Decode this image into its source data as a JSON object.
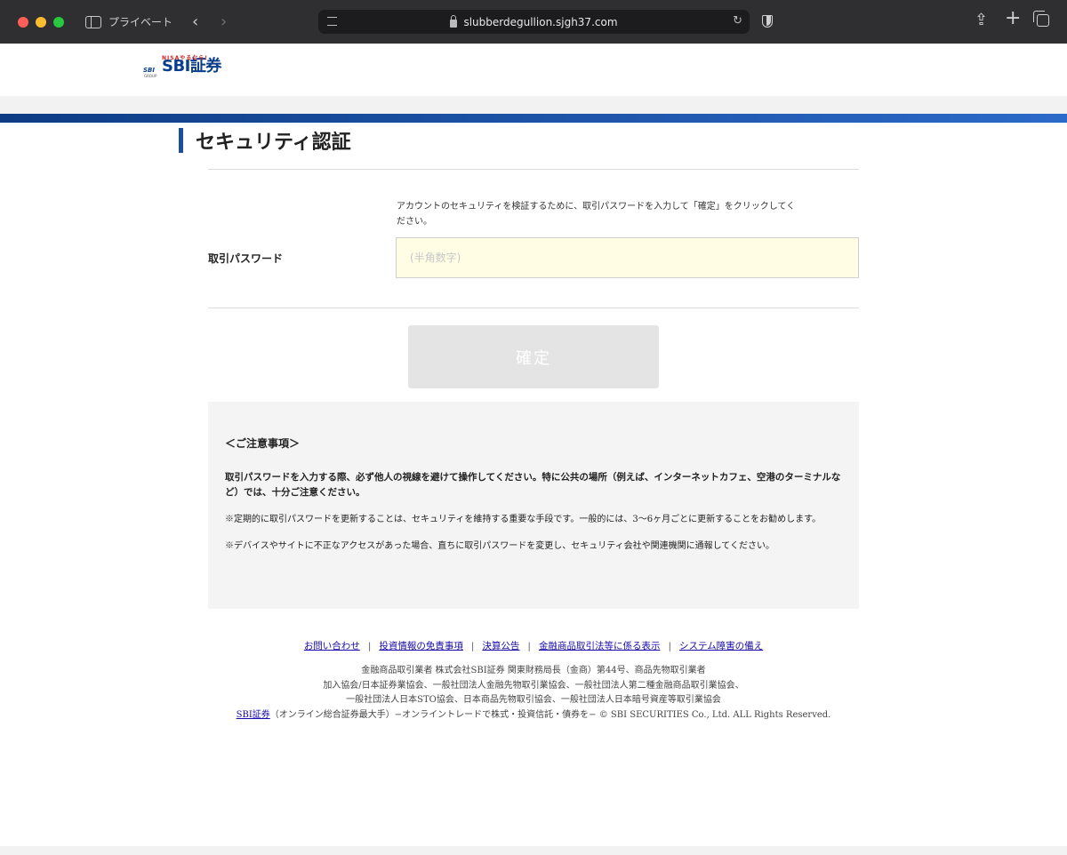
{
  "browser": {
    "private_label": "プライベート",
    "url": "slubberdegullion.sjgh37.com",
    "back_icon": "chevron-left-icon",
    "forward_icon": "chevron-right-icon",
    "share_icon": "share-icon",
    "new_tab_icon": "plus-icon",
    "tabs_icon": "tabs-icon"
  },
  "header": {
    "logo_text": "SBI証券",
    "logo_mark": "SBI",
    "logo_group": "GROUP",
    "logo_tagline": "NISAやるなら!",
    "brand_color": "#0a3e8c",
    "band_color": "#1e4e9a"
  },
  "main": {
    "title": "セキュリティ認証",
    "description": "アカウントのセキュリティを検証するために、取引パスワードを入力して「確定」をクリックしてください。",
    "password_label": "取引パスワード",
    "password_placeholder": "(半角数字)",
    "password_value": "",
    "confirm_label": "確定"
  },
  "notice": {
    "heading": "＜ご注意事項＞",
    "emphasis": "取引パスワードを入力する際、必ず他人の視線を避けて操作してください。特に公共の場所（例えば、インターネットカフェ、空港のターミナルなど）では、十分ご注意ください。",
    "notes": [
      "※定期的に取引パスワードを更新することは、セキュリティを維持する重要な手段です。一般的には、3〜6ヶ月ごとに更新することをお勧めします。",
      "※デバイスやサイトに不正なアクセスがあった場合、直ちに取引パスワードを変更し、セキュリティ会社や関連機関に通報してください。"
    ]
  },
  "footer": {
    "links": [
      "お問い合わせ",
      "投資情報の免責事項",
      "決算公告",
      "金融商品取引法等に係る表示",
      "システム障害の備え"
    ],
    "separator": "|",
    "line1": "金融商品取引業者 株式会社SBI証券 関東財務局長（金商）第44号、商品先物取引業者",
    "line2": "加入協会/日本証券業協会、一般社団法人金融先物取引業協会、一般社団法人第二種金融商品取引業協会、",
    "line3": "一般社団法人日本STO協会、日本商品先物取引協会、一般社団法人日本暗号資産等取引業協会",
    "line4_link": "SBI証券",
    "line4_text": "（オンライン総合証券最大手）−オンライントレードで株式・投資信託・債券を− © SBI SECURITIES Co., Ltd. ALL Rights Reserved."
  }
}
